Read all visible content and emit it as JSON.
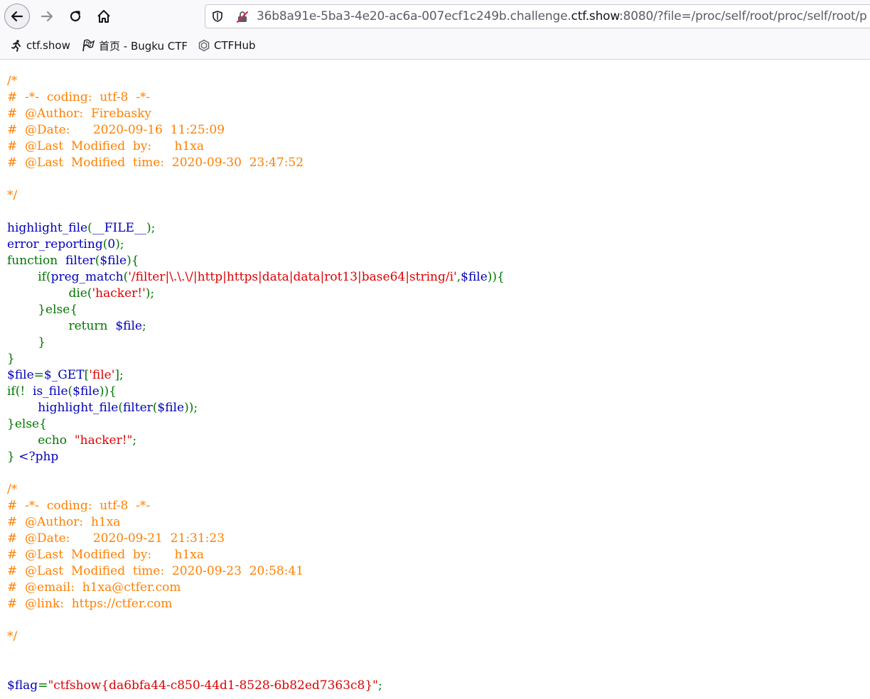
{
  "browser": {
    "url_prefix": "36b8a91e-5ba3-4e20-ac6a-007ecf1c249b.challenge.",
    "url_domain": "ctf.show",
    "url_suffix": ":8080/?file=/proc/self/root/proc/self/root/p"
  },
  "bookmarks": [
    {
      "label": "ctf.show",
      "icon": "runner-icon"
    },
    {
      "label": "首页 - Bugku CTF",
      "icon": "flag-icon"
    },
    {
      "label": "CTFHub",
      "icon": "hexagon-icon"
    }
  ],
  "colors": {
    "comment": "#ff8000",
    "keyword": "#007700",
    "default": "#0000bb",
    "string": "#dd0000"
  },
  "code_lines": [
    [
      [
        "c",
        "/*"
      ]
    ],
    [
      [
        "c",
        "#  -*-  coding:  utf-8  -*-"
      ]
    ],
    [
      [
        "c",
        "#  @Author:  Firebasky"
      ]
    ],
    [
      [
        "c",
        "#  @Date:      2020-09-16  11:25:09"
      ]
    ],
    [
      [
        "c",
        "#  @Last  Modified  by:      h1xa"
      ]
    ],
    [
      [
        "c",
        "#  @Last  Modified  time:  2020-09-30  23:47:52"
      ]
    ],
    [
      [
        "c",
        ""
      ]
    ],
    [
      [
        "c",
        "*/"
      ]
    ],
    [
      [
        "d",
        ""
      ]
    ],
    [
      [
        "d",
        "highlight_file"
      ],
      [
        "k",
        "("
      ],
      [
        "d",
        "__FILE__"
      ],
      [
        "k",
        ");"
      ]
    ],
    [
      [
        "d",
        "error_reporting"
      ],
      [
        "k",
        "("
      ],
      [
        "d",
        "0"
      ],
      [
        "k",
        ");"
      ]
    ],
    [
      [
        "k",
        "function  "
      ],
      [
        "d",
        "filter"
      ],
      [
        "k",
        "("
      ],
      [
        "d",
        "$file"
      ],
      [
        "k",
        "){"
      ]
    ],
    [
      [
        "k",
        "        if("
      ],
      [
        "d",
        "preg_match"
      ],
      [
        "k",
        "("
      ],
      [
        "s",
        "'/filter|\\.\\.\\/|http|https|data|data|rot13|base64|string/i'"
      ],
      [
        "k",
        ","
      ],
      [
        "d",
        "$file"
      ],
      [
        "k",
        ")){"
      ]
    ],
    [
      [
        "k",
        "                die("
      ],
      [
        "s",
        "'hacker!'"
      ],
      [
        "k",
        ");"
      ]
    ],
    [
      [
        "k",
        "        }else{"
      ]
    ],
    [
      [
        "k",
        "                return  "
      ],
      [
        "d",
        "$file"
      ],
      [
        "k",
        ";"
      ]
    ],
    [
      [
        "k",
        "        }"
      ]
    ],
    [
      [
        "k",
        "}"
      ]
    ],
    [
      [
        "d",
        "$file"
      ],
      [
        "k",
        "="
      ],
      [
        "d",
        "$_GET"
      ],
      [
        "k",
        "["
      ],
      [
        "s",
        "'file'"
      ],
      [
        "k",
        "];"
      ]
    ],
    [
      [
        "k",
        "if(!  "
      ],
      [
        "d",
        "is_file"
      ],
      [
        "k",
        "("
      ],
      [
        "d",
        "$file"
      ],
      [
        "k",
        "))"
      ],
      [
        "k",
        "{"
      ]
    ],
    [
      [
        "k",
        "        "
      ],
      [
        "d",
        "highlight_file"
      ],
      [
        "k",
        "("
      ],
      [
        "d",
        "filter"
      ],
      [
        "k",
        "("
      ],
      [
        "d",
        "$file"
      ],
      [
        "k",
        "));"
      ]
    ],
    [
      [
        "k",
        "}else{"
      ]
    ],
    [
      [
        "k",
        "        echo  "
      ],
      [
        "s",
        "\"hacker!\""
      ],
      [
        "k",
        ";"
      ]
    ],
    [
      [
        "k",
        "} "
      ],
      [
        "d",
        "<?php"
      ]
    ],
    [
      [
        "d",
        ""
      ]
    ],
    [
      [
        "c",
        "/*"
      ]
    ],
    [
      [
        "c",
        "#  -*-  coding:  utf-8  -*-"
      ]
    ],
    [
      [
        "c",
        "#  @Author:  h1xa"
      ]
    ],
    [
      [
        "c",
        "#  @Date:      2020-09-21  21:31:23"
      ]
    ],
    [
      [
        "c",
        "#  @Last  Modified  by:      h1xa"
      ]
    ],
    [
      [
        "c",
        "#  @Last  Modified  time:  2020-09-23  20:58:41"
      ]
    ],
    [
      [
        "c",
        "#  @email:  h1xa@ctfer.com"
      ]
    ],
    [
      [
        "c",
        "#  @link:  https://ctfer.com"
      ]
    ],
    [
      [
        "c",
        ""
      ]
    ],
    [
      [
        "c",
        "*/"
      ]
    ],
    [
      [
        "d",
        ""
      ]
    ],
    [
      [
        "d",
        ""
      ]
    ],
    [
      [
        "d",
        "$flag"
      ],
      [
        "k",
        "="
      ],
      [
        "s",
        "\"ctfshow{da6bfa44-c850-44d1-8528-6b82ed7363c8}\""
      ],
      [
        "k",
        ";"
      ]
    ]
  ]
}
